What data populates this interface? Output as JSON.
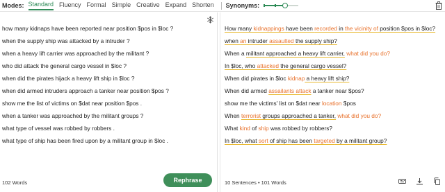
{
  "toolbar": {
    "modes_label": "Modes:",
    "modes": [
      {
        "label": "Standard",
        "active": true
      },
      {
        "label": "Fluency",
        "active": false
      },
      {
        "label": "Formal",
        "active": false
      },
      {
        "label": "Simple",
        "active": false
      },
      {
        "label": "Creative",
        "active": false
      },
      {
        "label": "Expand",
        "active": false
      },
      {
        "label": "Shorten",
        "active": false
      }
    ],
    "synonyms_label": "Synonyms:",
    "synonyms_level": 0.65,
    "accent_color": "#2e8b57"
  },
  "left_panel": {
    "lines": [
      "how many kidnaps have been reported near position $pos in $loc ?",
      "when the supply ship was attacked by a intruder ?",
      "when a heavy lift carrier was approached by the militant ?",
      "who did attack the general cargo vessel in $loc ?",
      "when did the pirates hijack a heavy lift ship in $loc ?",
      "when did armed intruders approach a tanker near position $pos ?",
      "show me the list of victims on $dat near position $pos .",
      "when a tanker was approached by the militant groups ?",
      "what type of vessel was robbed by robbers .",
      "what type of ship has been fired upon by a militant group in $loc ."
    ],
    "word_count": "102 Words",
    "rephrase_label": "Rephrase"
  },
  "right_panel": {
    "lines": [
      [
        {
          "t": "How many ",
          "c": "n",
          "u": true
        },
        {
          "t": "kidnappings",
          "c": "o",
          "u": true
        },
        {
          "t": " have been ",
          "c": "n",
          "u": true
        },
        {
          "t": "recorded",
          "c": "o",
          "u": true
        },
        {
          "t": " in ",
          "c": "n",
          "u": true
        },
        {
          "t": "the vicinity of",
          "c": "o",
          "u": true
        },
        {
          "t": " position $pos in $loc?",
          "c": "n",
          "u": true
        }
      ],
      [
        {
          "t": "when ",
          "c": "n",
          "u": true
        },
        {
          "t": "an",
          "c": "o",
          "u": true
        },
        {
          "t": " intruder ",
          "c": "n",
          "u": true
        },
        {
          "t": "assaulted",
          "c": "o",
          "u": true
        },
        {
          "t": " the supply ship?",
          "c": "n",
          "u": true
        }
      ],
      [
        {
          "t": "When a ",
          "c": "n",
          "u": false
        },
        {
          "t": "militant approached a heavy lift carrier,",
          "c": "n",
          "u": true
        },
        {
          "t": " ",
          "c": "n",
          "u": false
        },
        {
          "t": "what did you do?",
          "c": "o",
          "u": false
        }
      ],
      [
        {
          "t": "In $loc, who ",
          "c": "n",
          "u": true
        },
        {
          "t": "attacked",
          "c": "o",
          "u": true
        },
        {
          "t": " the general cargo vessel?",
          "c": "n",
          "u": true
        }
      ],
      [
        {
          "t": "When did pirates in $loc ",
          "c": "n",
          "u": false
        },
        {
          "t": "kidnap",
          "c": "o",
          "u": false
        },
        {
          "t": " a heavy lift ship?",
          "c": "n",
          "u": true
        }
      ],
      [
        {
          "t": "When did armed ",
          "c": "n",
          "u": false
        },
        {
          "t": "assailants attack",
          "c": "o",
          "u": true
        },
        {
          "t": " a tanker near $pos?",
          "c": "n",
          "u": false
        }
      ],
      [
        {
          "t": "show me the victims' list on $dat near ",
          "c": "n",
          "u": false
        },
        {
          "t": "location",
          "c": "o",
          "u": false
        },
        {
          "t": " $pos",
          "c": "n",
          "u": false
        }
      ],
      [
        {
          "t": "When ",
          "c": "n",
          "u": false
        },
        {
          "t": "terrorist",
          "c": "o",
          "u": true
        },
        {
          "t": " groups approached a tanker,",
          "c": "n",
          "u": true
        },
        {
          "t": " ",
          "c": "n",
          "u": false
        },
        {
          "t": "what did you do?",
          "c": "o",
          "u": false
        }
      ],
      [
        {
          "t": "What ",
          "c": "n",
          "u": false
        },
        {
          "t": "kind",
          "c": "o",
          "u": false
        },
        {
          "t": " of ",
          "c": "n",
          "u": false
        },
        {
          "t": "ship",
          "c": "o",
          "u": false
        },
        {
          "t": " was robbed by robbers?",
          "c": "n",
          "u": false
        }
      ],
      [
        {
          "t": "In $loc, what ",
          "c": "n",
          "u": true
        },
        {
          "t": "sort",
          "c": "o",
          "u": true
        },
        {
          "t": " of ship has been ",
          "c": "n",
          "u": true
        },
        {
          "t": "targeted",
          "c": "o",
          "u": true
        },
        {
          "t": " by a militant group?",
          "c": "n",
          "u": true
        }
      ]
    ],
    "stats": "10 Sentences • 101 Words"
  },
  "icons": {
    "freeze": "snowflake-icon",
    "delete": "trash-icon",
    "keyboard": "keyboard-icon",
    "download": "download-icon",
    "copy": "copy-icon"
  }
}
